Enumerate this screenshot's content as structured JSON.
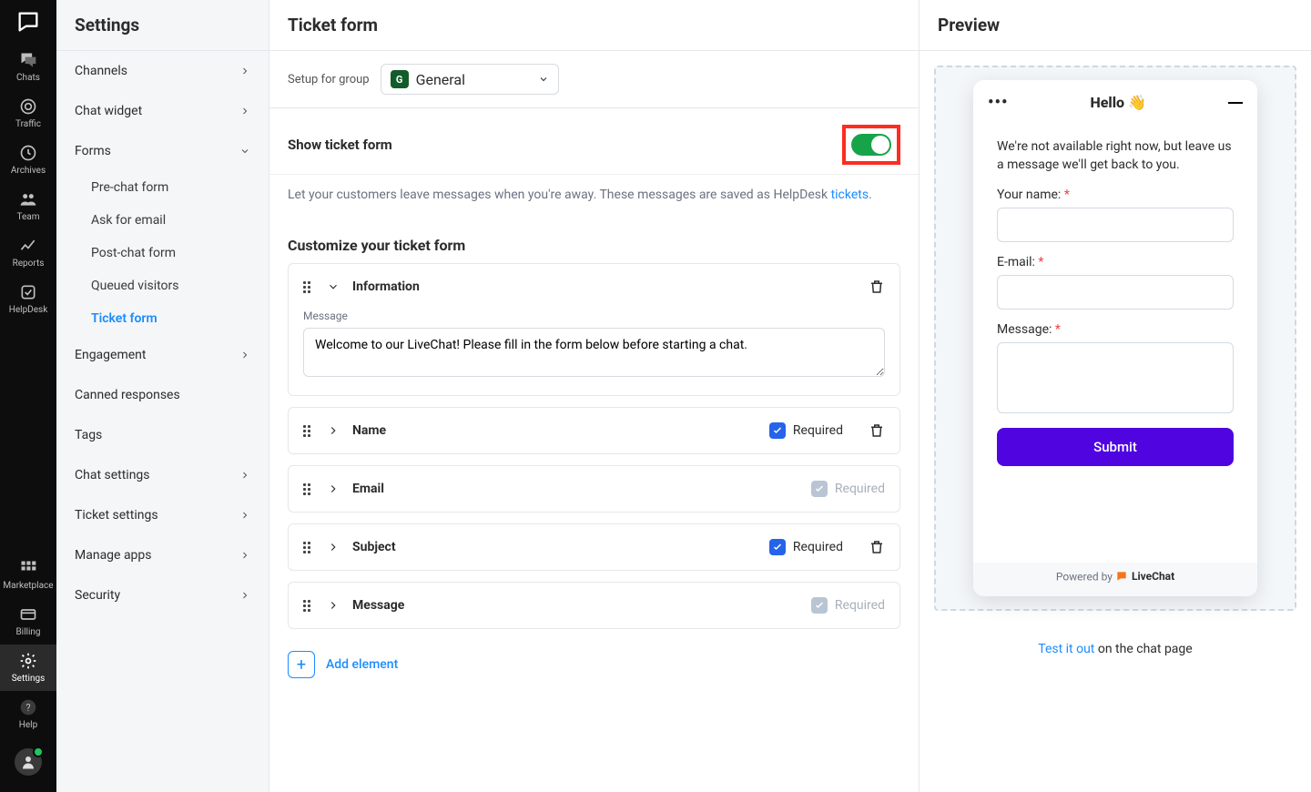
{
  "rail": {
    "items": [
      {
        "label": "Chats"
      },
      {
        "label": "Traffic"
      },
      {
        "label": "Archives"
      },
      {
        "label": "Team"
      },
      {
        "label": "Reports"
      },
      {
        "label": "HelpDesk"
      }
    ],
    "bottom": [
      {
        "label": "Marketplace"
      },
      {
        "label": "Billing"
      },
      {
        "label": "Settings"
      },
      {
        "label": "Help"
      }
    ]
  },
  "sidebar": {
    "title": "Settings",
    "items": [
      {
        "label": "Channels",
        "chev": true
      },
      {
        "label": "Chat widget",
        "chev": true
      },
      {
        "label": "Forms",
        "chev": true,
        "expanded": true
      },
      {
        "label": "Engagement",
        "chev": true
      },
      {
        "label": "Canned responses",
        "chev": false
      },
      {
        "label": "Tags",
        "chev": false
      },
      {
        "label": "Chat settings",
        "chev": true
      },
      {
        "label": "Ticket settings",
        "chev": true
      },
      {
        "label": "Manage apps",
        "chev": true
      },
      {
        "label": "Security",
        "chev": true
      }
    ],
    "forms_sub": [
      "Pre-chat form",
      "Ask for email",
      "Post-chat form",
      "Queued visitors",
      "Ticket form"
    ]
  },
  "page": {
    "title": "Ticket form",
    "group_label": "Setup for group",
    "group_badge": "G",
    "group_name": "General",
    "show_label": "Show ticket form",
    "help_pre": "Let your customers leave messages when you're away. These messages are saved as HelpDesk ",
    "help_link": "tickets",
    "help_post": ".",
    "customize": "Customize your ticket form",
    "info_title": "Information",
    "msg_label": "Message",
    "msg_value": "Welcome to our LiveChat! Please fill in the form below before starting a chat.",
    "rows": [
      {
        "title": "Name",
        "required": true,
        "locked": false,
        "trash": true
      },
      {
        "title": "Email",
        "required": true,
        "locked": true,
        "trash": false
      },
      {
        "title": "Subject",
        "required": true,
        "locked": false,
        "trash": true
      },
      {
        "title": "Message",
        "required": true,
        "locked": true,
        "trash": false
      }
    ],
    "required_label": "Required",
    "add": "Add element"
  },
  "preview": {
    "title": "Preview",
    "hello": "Hello 👋",
    "intro": "We're not available right now, but leave us a message we'll get back to you.",
    "name": "Your name:",
    "email": "E-mail:",
    "message": "Message:",
    "submit": "Submit",
    "powered": "Powered by",
    "brand": "LiveChat",
    "test_link": "Test it out",
    "test_rest": " on the chat page"
  }
}
